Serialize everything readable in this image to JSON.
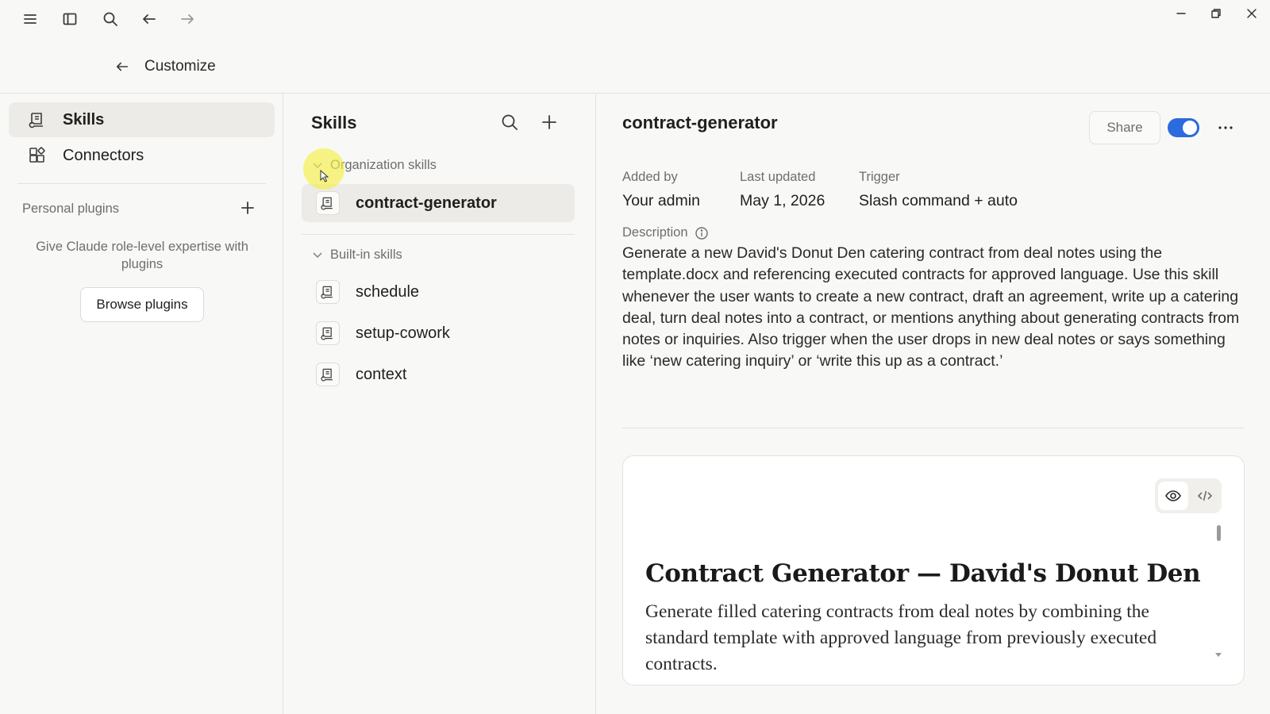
{
  "window": {
    "menu_icon": "hamburger-icon",
    "sidebar_icon": "sidebar-toggle-icon",
    "search_icon": "search-icon",
    "back_icon": "arrow-left-icon",
    "forward_icon": "arrow-right-icon"
  },
  "header": {
    "back_icon": "arrow-left-icon",
    "title": "Customize"
  },
  "sidebar": {
    "items": [
      {
        "label": "Skills",
        "icon": "skill-icon",
        "active": true
      },
      {
        "label": "Connectors",
        "icon": "connectors-icon",
        "active": false
      }
    ],
    "personal_plugins": {
      "label": "Personal plugins",
      "help_text": "Give Claude role-level expertise with plugins",
      "browse_button": "Browse plugins"
    }
  },
  "skills_list": {
    "title": "Skills",
    "groups": [
      {
        "label": "Organization skills",
        "items": [
          {
            "label": "contract-generator",
            "active": true
          }
        ]
      },
      {
        "label": "Built-in skills",
        "items": [
          {
            "label": "schedule"
          },
          {
            "label": "setup-cowork"
          },
          {
            "label": "context"
          }
        ]
      }
    ]
  },
  "detail": {
    "title": "contract-generator",
    "share_label": "Share",
    "enabled": true,
    "meta": [
      {
        "label": "Added by",
        "value": "Your admin"
      },
      {
        "label": "Last updated",
        "value": "May 1, 2026"
      },
      {
        "label": "Trigger",
        "value": "Slash command + auto"
      }
    ],
    "description_label": "Description",
    "description": "Generate a new David's Donut Den catering contract from deal notes using the template.docx and referencing executed contracts for approved language. Use this skill whenever the user wants to create a new contract, draft an agreement, write up a catering deal, turn deal notes into a contract, or mentions anything about generating contracts from notes or inquiries. Also trigger when the user drops in new deal notes or says something like ‘new catering inquiry’ or ‘write this up as a contract.’",
    "preview": {
      "heading": "Contract Generator — David's Donut Den",
      "body": "Generate filled catering contracts from deal notes by combining the standard template with approved language from previously executed contracts."
    }
  },
  "colors": {
    "accent": "#2c6ae0",
    "background": "#f8f8f6",
    "active_row": "#ecebe7",
    "cursor_highlight": "#f5f046"
  }
}
